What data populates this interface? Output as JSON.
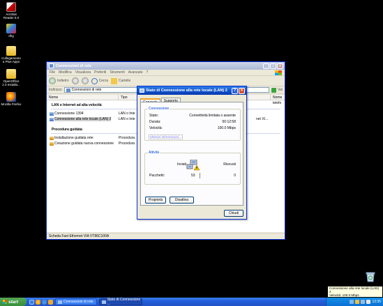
{
  "desktop": {
    "icons": [
      {
        "label": "Acrobat Reader 5.0",
        "icon": "acrobat-icon"
      },
      {
        "label": "dhg",
        "icon": "dhg-icon"
      },
      {
        "label": "Collegamento a Plus-Apps",
        "icon": "folder-shortcut-icon"
      },
      {
        "label": "OpenOffice 2.3 Installa...",
        "icon": "folder-icon"
      },
      {
        "label": "Mozilla Firefox",
        "icon": "firefox-icon"
      }
    ]
  },
  "explorer": {
    "title": "Connessioni di rete",
    "menu": [
      "File",
      "Modifica",
      "Visualizza",
      "Preferiti",
      "Strumenti",
      "Avanzate",
      "?"
    ],
    "toolbar": {
      "back": "Indietro",
      "search": "Cerca",
      "folders": "Cartelle"
    },
    "address_label": "Indirizzo",
    "address_value": "Connessioni di rete",
    "go_label": "Vai",
    "columns": [
      "Nome",
      "Tipo",
      "Nome telefo"
    ],
    "groups": [
      {
        "title": "LAN o Internet ad alta velocità",
        "rows": [
          {
            "name": "Connessione 1394",
            "type": "LAN o Inte",
            "extra": ""
          },
          {
            "name": "Connessione alla rete locale (LAN) 2",
            "type": "LAN o Inte",
            "extra": "net XI..."
          }
        ]
      },
      {
        "title": "Procedura guidata",
        "rows": [
          {
            "name": "Installazione guidata rete",
            "type": "Procedura",
            "extra": ""
          },
          {
            "name": "Creazione guidata nuova connessione",
            "type": "Procedura",
            "extra": ""
          }
        ]
      }
    ],
    "status": "Scheda Fast Ethernet VIA VT86C100A"
  },
  "dialog": {
    "title": "Stato di Connessione alla rete locale (LAN) 2",
    "tabs": [
      "Generale",
      "Supporto"
    ],
    "connection": {
      "legend": "Connessione",
      "state_label": "Stato:",
      "state_value": "Connettività limitata o assente",
      "duration_label": "Durata:",
      "duration_value": "00:12:58",
      "speed_label": "Velocità:",
      "speed_value": "100.0 Mbps",
      "info_link": "Ulteriori informazioni..."
    },
    "activity": {
      "legend": "Attività",
      "sent_label": "Inviati",
      "received_label": "Ricevuti",
      "packets_label": "Pacchetti:",
      "packets_sent": "53",
      "packets_received": "0"
    },
    "buttons": {
      "properties": "Proprietà",
      "disable": "Disattiva",
      "close": "Chiudi"
    }
  },
  "taskbar": {
    "start_label": "start",
    "tasks": [
      {
        "label": "Connessioni di rete"
      },
      {
        "label": "Stato di Connessione ..."
      }
    ],
    "clock": "12:35"
  },
  "balloon": {
    "line1": "Connessione alla rete locale (LAN) 2",
    "line2": "Velocità: 100.0 Mbps",
    "line3": "Stato: Connettività limitata o assente"
  }
}
